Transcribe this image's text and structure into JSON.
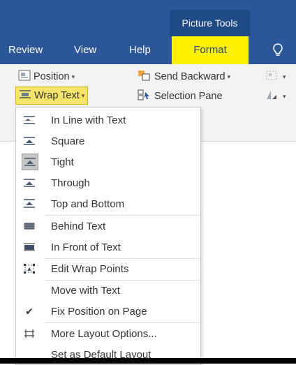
{
  "titlebar": {
    "context_label": "Picture Tools"
  },
  "tabs": {
    "review": "Review",
    "view": "View",
    "help": "Help",
    "format": "Format"
  },
  "ribbon": {
    "position_label": "Position",
    "wrap_text_label": "Wrap Text",
    "send_backward_label": "Send Backward",
    "selection_pane_label": "Selection Pane"
  },
  "menu": {
    "items": [
      {
        "label": "In Line with Text",
        "icon": "inline-wrap-icon"
      },
      {
        "label": "Square",
        "icon": "square-wrap-icon"
      },
      {
        "label": "Tight",
        "icon": "tight-wrap-icon",
        "selected": true
      },
      {
        "label": "Through",
        "icon": "through-wrap-icon"
      },
      {
        "label": "Top and Bottom",
        "icon": "top-bottom-wrap-icon"
      },
      {
        "label": "Behind Text",
        "icon": "behind-text-icon"
      },
      {
        "label": "In Front of Text",
        "icon": "in-front-text-icon"
      },
      {
        "label": "Edit Wrap Points",
        "icon": "edit-wrap-points-icon"
      },
      {
        "label": "Move with Text",
        "icon": ""
      },
      {
        "label": "Fix Position on Page",
        "icon": "checkmark-icon",
        "checked": true
      },
      {
        "label": "More Layout Options...",
        "icon": "layout-options-icon"
      },
      {
        "label": "Set as Default Layout",
        "icon": ""
      }
    ]
  },
  "colors": {
    "ribbon_blue": "#2b579a",
    "format_tab_highlight": "#fff200",
    "wrap_text_highlight": "#f5e36a"
  }
}
